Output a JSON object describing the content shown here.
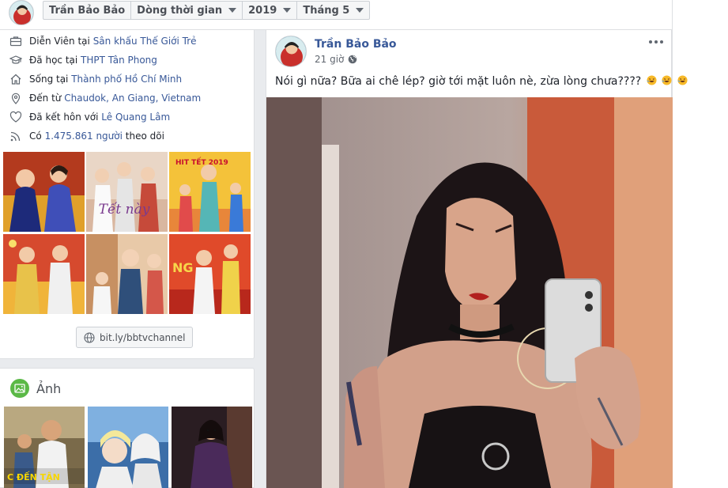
{
  "profile_name": "Trần Bảo Bảo",
  "topbar": {
    "crumbs": [
      {
        "label": "Trần Bảo Bảo",
        "dropdown": false
      },
      {
        "label": "Dòng thời gian",
        "dropdown": true
      },
      {
        "label": "2019",
        "dropdown": true
      },
      {
        "label": "Tháng 5",
        "dropdown": true
      }
    ]
  },
  "intro": {
    "work": {
      "prefix": "Diễn Viên tại",
      "link": "Sân khấu Thế Giới Trẻ",
      "icon": "briefcase-icon"
    },
    "education": {
      "prefix": "Đã học tại",
      "link": "THPT Tân Phong",
      "icon": "graduation-cap-icon"
    },
    "lives": {
      "prefix": "Sống tại",
      "link": "Thành phố Hồ Chí Minh",
      "icon": "home-icon"
    },
    "from": {
      "prefix": "Đến từ",
      "link": "Chaudok, An Giang, Vietnam",
      "icon": "location-pin-icon"
    },
    "relationship": {
      "prefix": "Đã kết hôn với",
      "link": "Lê Quang Lâm",
      "icon": "heart-icon"
    },
    "followers": {
      "prefix": "Có",
      "link": "1.475.861 người",
      "suffix": "theo dõi",
      "icon": "rss-icon"
    },
    "featured_tiles": [
      {
        "overlay_text": ""
      },
      {
        "overlay_text": "Tết này"
      },
      {
        "overlay_text": "HIT TẾT 2019"
      },
      {
        "overlay_text": ""
      },
      {
        "overlay_text": ""
      },
      {
        "overlay_text": "NG"
      }
    ],
    "website": "bit.ly/bbtvchannel"
  },
  "photos": {
    "title": "Ảnh",
    "thumb_caption": "C ĐẾN TẬN"
  },
  "post": {
    "author": "Trần Bảo Bảo",
    "time": "21 giờ",
    "audience_icon": "globe-icon",
    "text": "Nói gì nữa? Bữa ai chê lép? giờ tới mặt luôn nè, zừa lòng chưa????",
    "emoji_count": 3
  },
  "colors": {
    "link": "#385898",
    "background": "#e9ebee",
    "photos_icon": "#5bb947"
  }
}
